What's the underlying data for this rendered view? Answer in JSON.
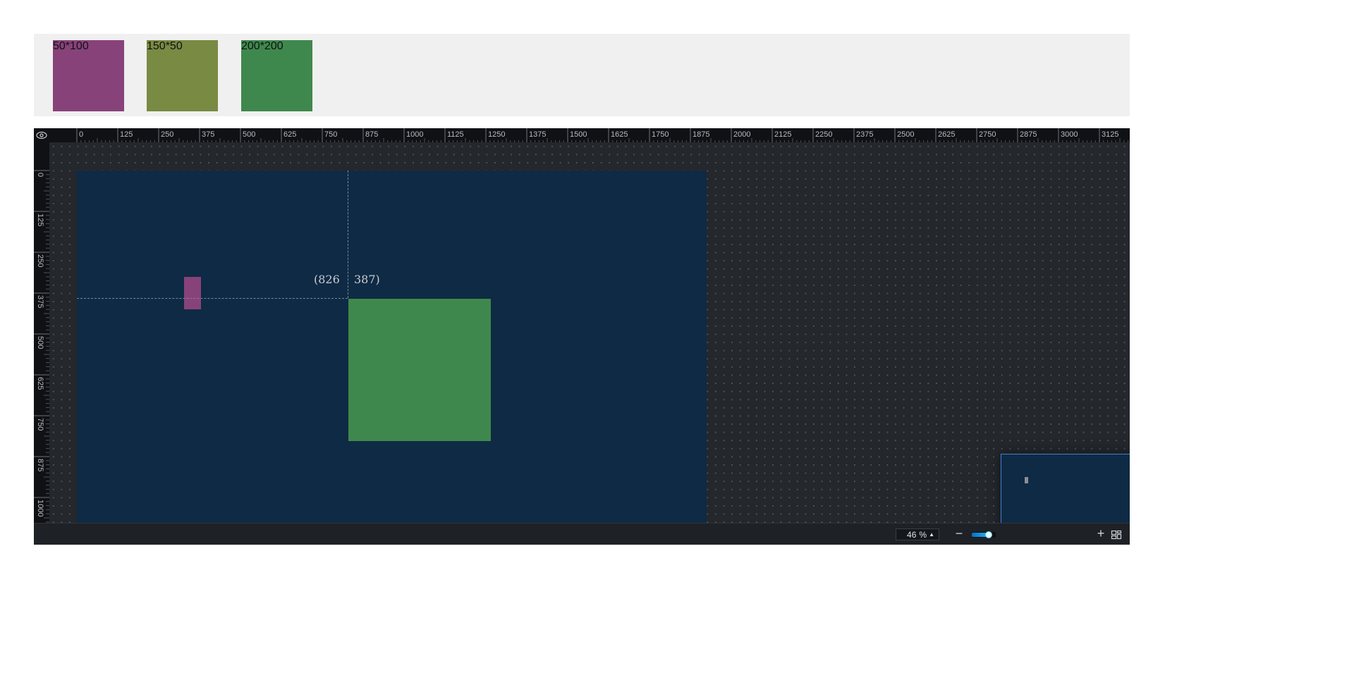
{
  "palette": {
    "items": [
      {
        "label": "50*100",
        "color": "#88427a"
      },
      {
        "label": "150*50",
        "color": "#798a43"
      },
      {
        "label": "200*200",
        "color": "#3f884d"
      }
    ]
  },
  "ruler": {
    "horizontal_ticks": [
      "0",
      "125",
      "250",
      "375",
      "500",
      "625",
      "750",
      "875",
      "1000",
      "1125",
      "1250",
      "1375",
      "1500",
      "1625",
      "1750",
      "1875",
      "2000",
      "2125",
      "2250",
      "2375",
      "2500",
      "2625",
      "2750",
      "2875",
      "3000",
      "3125"
    ],
    "vertical_ticks": [
      "0",
      "125",
      "250",
      "375",
      "500",
      "625",
      "750",
      "875",
      "1000"
    ],
    "corner_icon": "eye-icon"
  },
  "canvas": {
    "background": "#0f2a44",
    "shapes": [
      {
        "name": "shape-50x100",
        "color": "#88427a"
      },
      {
        "name": "shape-200x200",
        "color": "#3f884d"
      }
    ],
    "guide_coordinates": {
      "x": "(826",
      "y": "387)"
    }
  },
  "minimap": {
    "accent": "#3f7fd6"
  },
  "zoom": {
    "value": "46",
    "unit": "%",
    "slider_fraction": 0.72,
    "minus_icon": "minus-icon",
    "plus_icon": "plus-icon",
    "layout_icon": "layout-grid-icon"
  }
}
